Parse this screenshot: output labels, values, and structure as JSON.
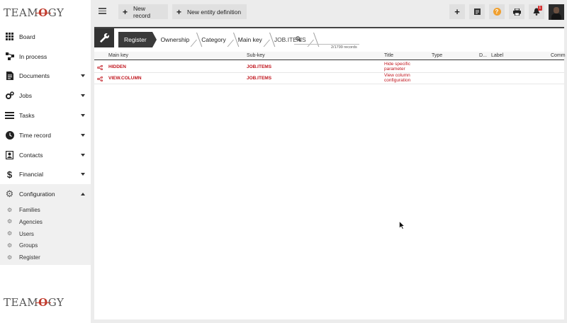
{
  "brand": {
    "logo_prefix": "TEAM",
    "logo_mark": "O",
    "logo_suffix": "GY"
  },
  "sidebar": {
    "items": [
      {
        "label": "Board",
        "icon": "grid-icon",
        "has_caret": false
      },
      {
        "label": "In process",
        "icon": "process-icon",
        "has_caret": false
      },
      {
        "label": "Documents",
        "icon": "document-icon",
        "has_caret": true
      },
      {
        "label": "Jobs",
        "icon": "jobs-gear-icon",
        "has_caret": true
      },
      {
        "label": "Tasks",
        "icon": "tasks-icon",
        "has_caret": true
      },
      {
        "label": "Time record",
        "icon": "clock-icon",
        "has_caret": true
      },
      {
        "label": "Contacts",
        "icon": "contacts-icon",
        "has_caret": true
      },
      {
        "label": "Financial",
        "icon": "dollar-icon",
        "has_caret": true
      },
      {
        "label": "Configuration",
        "icon": "gear-icon",
        "has_caret": true
      }
    ],
    "submenu": [
      "Families",
      "Agencies",
      "Users",
      "Groups",
      "Register"
    ]
  },
  "topbar": {
    "new_record_label": "New record",
    "new_entity_label": "New entity definition",
    "help_glyph": "?",
    "notification_count": "1"
  },
  "breadcrumb": {
    "items": [
      "Register",
      "Ownership",
      "Category",
      "Main key",
      "JOB.ITEMS"
    ]
  },
  "search": {
    "placeholder": "",
    "value": "",
    "record_count": "2/1799 records"
  },
  "table": {
    "columns": [
      "Main key",
      "Sub-key",
      "Title",
      "Type",
      "D...",
      "Label",
      "Comm"
    ],
    "rows": [
      {
        "main_key": "HIDDEN",
        "sub_key": "JOB.ITEMS",
        "title_line1": "Hide specific",
        "title_line2": "parameter"
      },
      {
        "main_key": "VIEW.COLUMN",
        "sub_key": "JOB.ITEMS",
        "title_line1": "View column",
        "title_line2": "configuration"
      }
    ]
  },
  "colors": {
    "accent": "#c0161e",
    "dark": "#3b3b3b",
    "help": "#f0a030",
    "badge": "#d32f2f"
  }
}
